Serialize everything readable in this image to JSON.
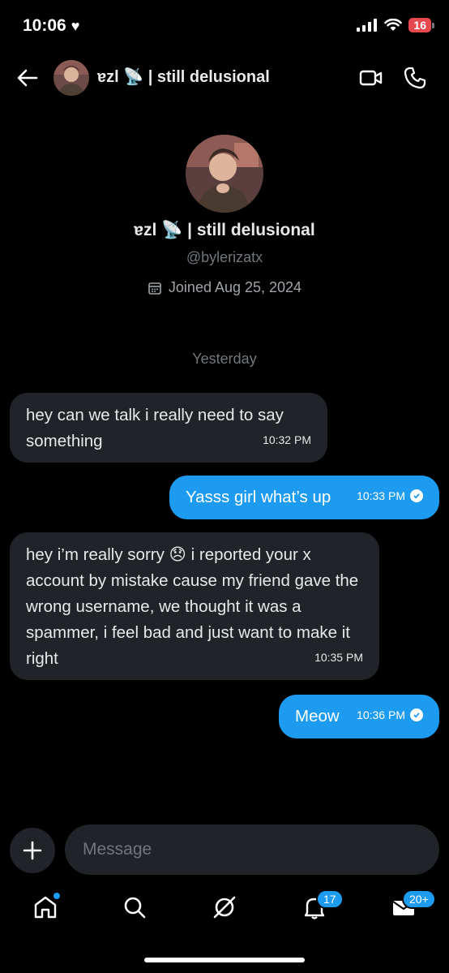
{
  "status_bar": {
    "time": "10:06",
    "battery": "16"
  },
  "header": {
    "title": "ɐzl 📡 | still delusional"
  },
  "profile": {
    "name": "ɐzl 📡 | still delusional",
    "handle": "@bylerizatx",
    "joined": "Joined Aug 25, 2024"
  },
  "day_separator": "Yesterday",
  "messages": [
    {
      "direction": "in",
      "text": "hey can we talk i really need to say something",
      "time": "10:32 PM"
    },
    {
      "direction": "out",
      "text": "Yasss girl what’s up",
      "time": "10:33 PM"
    },
    {
      "direction": "in",
      "text": "hey i’m really sorry 😞 i reported your x account by mistake cause my friend gave the wrong username, we thought it was a spammer, i feel bad and just want to make it right",
      "time": "10:35 PM"
    },
    {
      "direction": "out",
      "text": "Meow",
      "time": "10:36 PM"
    }
  ],
  "composer": {
    "placeholder": "Message"
  },
  "tab_bar": {
    "notifications_badge": "17",
    "messages_badge": "20+"
  },
  "colors": {
    "accent": "#1d9bf0",
    "incoming_bubble": "#202327",
    "background": "#000000"
  }
}
